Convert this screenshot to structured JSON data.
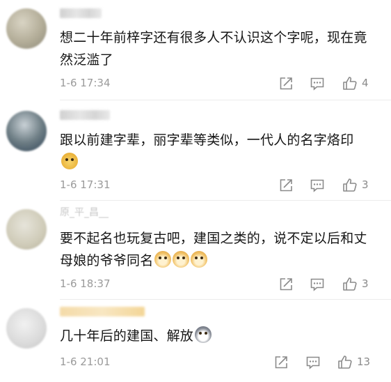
{
  "comments": [
    {
      "text": "想二十年前梓字还有很多人不认识这个字呢，现在竟然泛滥了",
      "time": "1-6 17:34",
      "likes": "4"
    },
    {
      "text": "跟以前建字辈，丽字辈等类似，一代人的名字烙印",
      "time": "1-6 17:31",
      "likes": "3"
    },
    {
      "name": "原_平_昌__",
      "text": "要不起名也玩复古吧，建国之类的，说不定以后和丈母娘的爷爷同名",
      "time": "1-6 18:37",
      "likes": "3"
    },
    {
      "text": "几十年后的建国、解放",
      "time": "1-6 21:01",
      "likes": "13"
    }
  ],
  "icons": {
    "share": "share-icon",
    "reply": "comment-icon",
    "like": "thumbs-up-icon",
    "emoji_1": "smiling-face-emoji-icon",
    "emoji_3": "doge-emoji-icon",
    "emoji_4": "husky-emoji-icon"
  },
  "colors": {
    "text": "#151515",
    "meta": "#9a9a9a",
    "icon": "#8a8a8a"
  }
}
